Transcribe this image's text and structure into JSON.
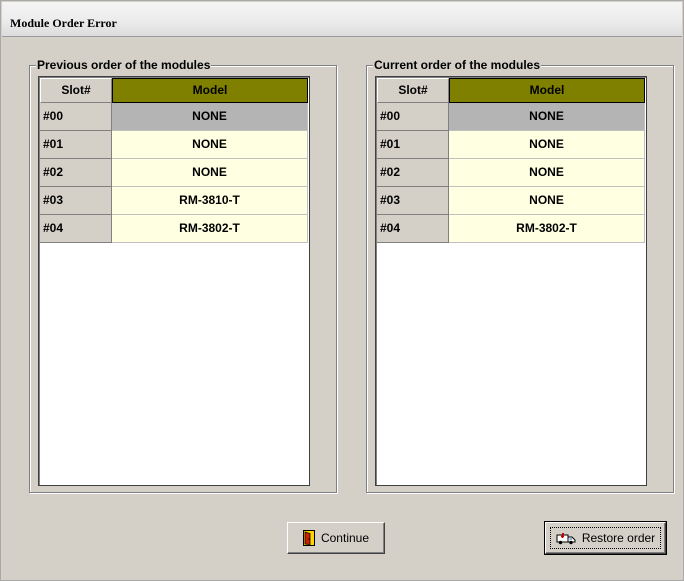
{
  "window": {
    "title": "Module Order Error"
  },
  "previous": {
    "label": "Previous order of the modules",
    "columns": {
      "slot": "Slot#",
      "model": "Model"
    },
    "rows": [
      {
        "slot": "#00",
        "model": "NONE"
      },
      {
        "slot": "#01",
        "model": "NONE"
      },
      {
        "slot": "#02",
        "model": "NONE"
      },
      {
        "slot": "#03",
        "model": "RM-3810-T"
      },
      {
        "slot": "#04",
        "model": "RM-3802-T"
      }
    ]
  },
  "current": {
    "label": "Current order of the modules",
    "columns": {
      "slot": "Slot#",
      "model": "Model"
    },
    "rows": [
      {
        "slot": "#00",
        "model": "NONE"
      },
      {
        "slot": "#01",
        "model": "NONE"
      },
      {
        "slot": "#02",
        "model": "NONE"
      },
      {
        "slot": "#03",
        "model": "NONE"
      },
      {
        "slot": "#04",
        "model": "RM-3802-T"
      }
    ]
  },
  "buttons": {
    "continue_label": "Continue",
    "continue_icon": "door-exit-icon",
    "restore_label": "Restore order",
    "restore_icon": "ambulance-icon"
  },
  "colors": {
    "window_bg": "#d4d0c8",
    "model_header": "#7f7f00",
    "model_cell": "#ffffe1",
    "selected_cell": "#b4b4b4"
  }
}
